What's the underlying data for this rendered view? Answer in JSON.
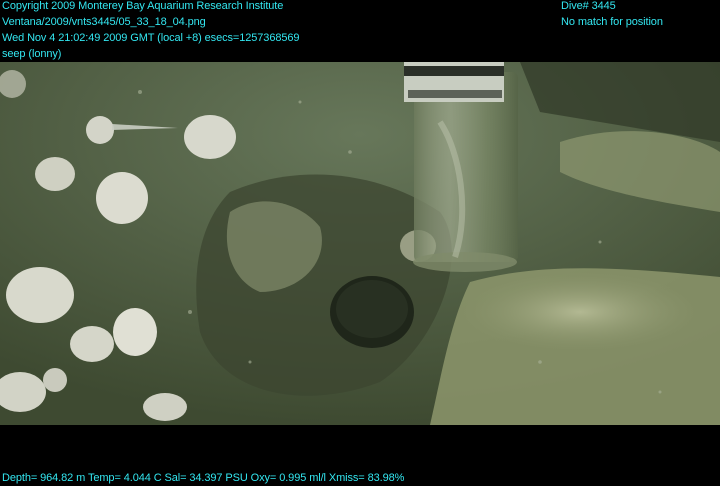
{
  "overlay": {
    "copyright": "Copyright 2009 Monterey Bay Aquarium Research Institute",
    "file_path": "Ventana/2009/vnts3445/05_33_18_04.png",
    "timestamp": "Wed Nov  4 21:02:49 2009 GMT (local +8)  esecs=1257368569",
    "site": "seep (lonny)",
    "dive": "Dive# 3445",
    "position": "No match for position",
    "telemetry": "Depth= 964.82 m  Temp= 4.044 C  Sal= 34.397 PSU  Oxy= 0.995 ml/l  Xmiss= 83.98%"
  },
  "scene": {
    "subject": "push-core sampling at seafloor methane seep with clams and bacterial mat",
    "colors": {
      "water": "#56664a",
      "sediment": "#4a5638",
      "mat": "#a9b08a",
      "shell": "#d8d8cc",
      "core_tube": "#9aa48c",
      "text": "#33e6f0"
    }
  }
}
